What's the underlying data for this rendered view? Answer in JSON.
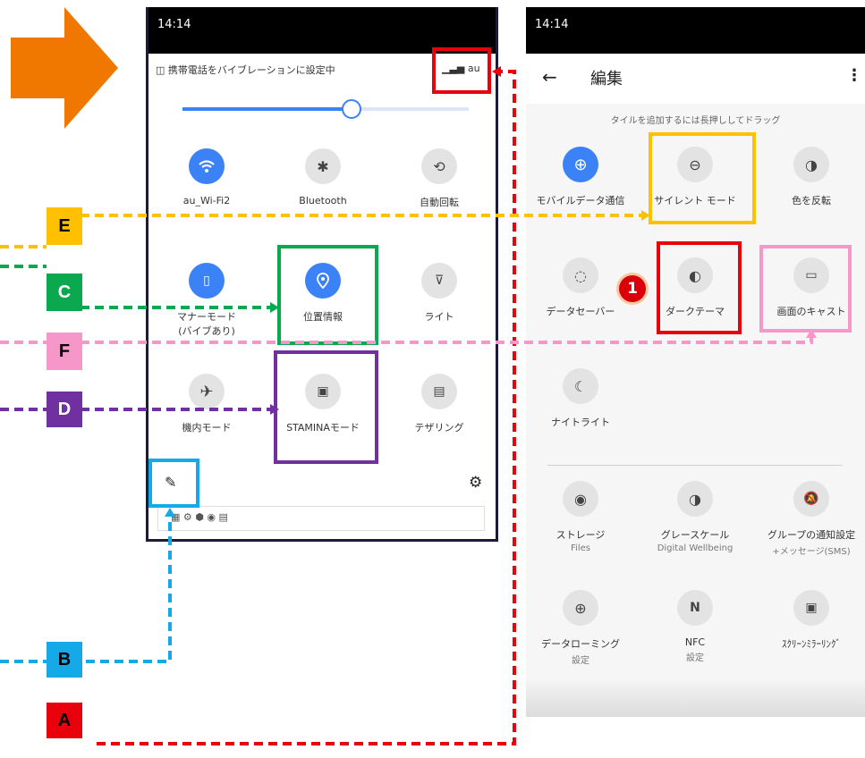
{
  "left_phone": {
    "status_time": "14:14",
    "notice": "携帯電話をバイブレーションに設定中",
    "carrier": "au",
    "brightness_pct": 59,
    "tiles": [
      {
        "label": "au_Wi-Fi2",
        "icon": "wifi-icon",
        "active": true
      },
      {
        "label": "Bluetooth",
        "icon": "bluetooth-icon",
        "active": false
      },
      {
        "label": "自動回転",
        "icon": "rotate-icon",
        "active": false
      },
      {
        "label": "マナーモード",
        "label2": "(バイブあり)",
        "icon": "vibrate-icon",
        "active": true
      },
      {
        "label": "位置情報",
        "icon": "location-icon",
        "active": true
      },
      {
        "label": "ライト",
        "icon": "flashlight-icon",
        "active": false
      },
      {
        "label": "機内モード",
        "icon": "airplane-icon",
        "active": false
      },
      {
        "label": "STAMINAモード",
        "icon": "battery-icon",
        "active": false
      },
      {
        "label": "テザリング",
        "icon": "tethering-icon",
        "active": false
      }
    ]
  },
  "right_phone": {
    "status_time": "14:14",
    "title": "編集",
    "hint": "タイルを追加するには長押ししてドラッグ",
    "tiles": [
      {
        "label": "モバイルデータ通信",
        "icon": "globe-icon",
        "active": true
      },
      {
        "label": "サイレント モード",
        "icon": "dnd-icon",
        "active": false
      },
      {
        "label": "色を反転",
        "icon": "invert-icon",
        "active": false
      },
      {
        "label": "データセーバー",
        "icon": "datasaver-icon",
        "active": false
      },
      {
        "label": "ダークテーマ",
        "icon": "dark-theme-icon",
        "active": false
      },
      {
        "label": "画面のキャスト",
        "icon": "cast-icon",
        "active": false
      },
      {
        "label": "ナイトライト",
        "icon": "nightlight-icon",
        "active": false
      }
    ],
    "extra_tiles": [
      {
        "label": "ストレージ",
        "sub": "Files",
        "icon": "storage-icon"
      },
      {
        "label": "グレースケール",
        "sub": "Digital Wellbeing",
        "icon": "grayscale-icon"
      },
      {
        "label": "グループの通知設定",
        "sub": "+メッセージ(SMS)",
        "icon": "bell-off-icon"
      },
      {
        "label": "データローミング",
        "sub": "設定",
        "icon": "roaming-icon"
      },
      {
        "label": "NFC",
        "sub": "設定",
        "icon": "nfc-icon"
      },
      {
        "label": "ｽｸﾘｰﾝﾐﾗｰﾘﾝｸﾞ",
        "sub": "",
        "icon": "screen-mirror-icon"
      }
    ],
    "badge": "1"
  },
  "callouts": {
    "A": "A",
    "B": "B",
    "C": "C",
    "D": "D",
    "E": "E",
    "F": "F"
  },
  "colors": {
    "red": "#e8000b",
    "blue": "#16a9e8",
    "green": "#0aa84f",
    "purple": "#7030a0",
    "yellow": "#ffc000",
    "pink": "#f597c8",
    "orange": "#f07800",
    "accent": "#3b82f6"
  }
}
